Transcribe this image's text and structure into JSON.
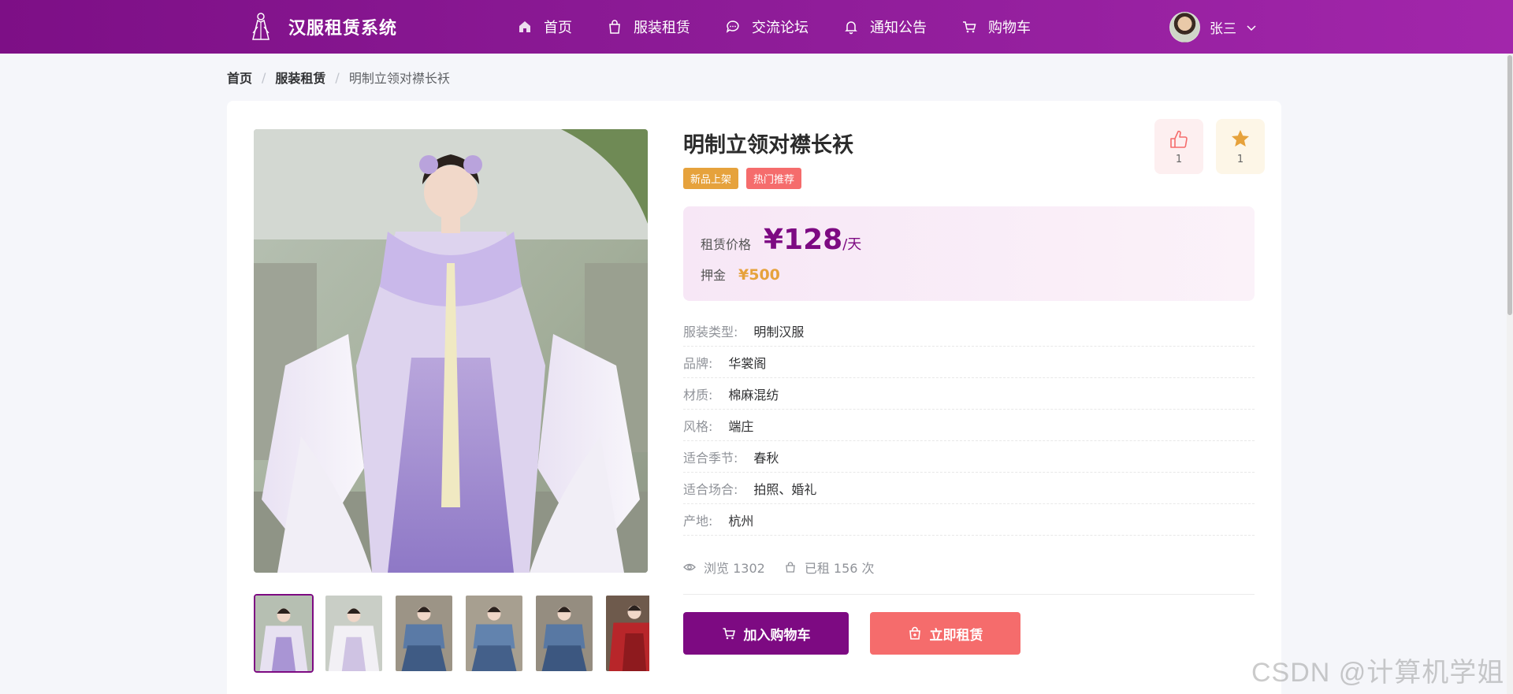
{
  "header": {
    "brand": "汉服租赁系统",
    "nav": [
      {
        "label": "首页",
        "icon": "home-icon"
      },
      {
        "label": "服装租赁",
        "icon": "shopping-bag-icon"
      },
      {
        "label": "交流论坛",
        "icon": "chat-icon"
      },
      {
        "label": "通知公告",
        "icon": "bell-icon"
      },
      {
        "label": "购物车",
        "icon": "cart-icon"
      }
    ],
    "user": {
      "name": "张三",
      "icon": "chevron-down-icon"
    }
  },
  "breadcrumb": {
    "home": "首页",
    "sep": "/",
    "category": "服装租赁",
    "current": "明制立领对襟长袄"
  },
  "product": {
    "title": "明制立领对襟长袄",
    "tags": [
      "新品上架",
      "热门推荐"
    ],
    "likes": "1",
    "favorites": "1",
    "price": {
      "label": "租赁价格",
      "value": "¥128",
      "unit": "/天"
    },
    "deposit": {
      "label": "押金",
      "value": "¥500"
    },
    "specs": [
      {
        "label": "服装类型:",
        "value": "明制汉服"
      },
      {
        "label": "品牌:",
        "value": "华裳阁"
      },
      {
        "label": "材质:",
        "value": "棉麻混纺"
      },
      {
        "label": "风格:",
        "value": "端庄"
      },
      {
        "label": "适合季节:",
        "value": "春秋"
      },
      {
        "label": "适合场合:",
        "value": "拍照、婚礼"
      },
      {
        "label": "产地:",
        "value": "杭州"
      }
    ],
    "stats": {
      "views": "浏览 1302",
      "rented": "已租 156 次"
    },
    "buttons": {
      "add_to_cart": "加入购物车",
      "rent_now": "立即租赁"
    },
    "selected_thumbnail": 1,
    "thumbnail_count": 6
  },
  "watermark": "CSDN @计算机学姐",
  "colors": {
    "brand": "#7d0a82",
    "accent_orange": "#e6a23c",
    "accent_red": "#f56c6c"
  }
}
